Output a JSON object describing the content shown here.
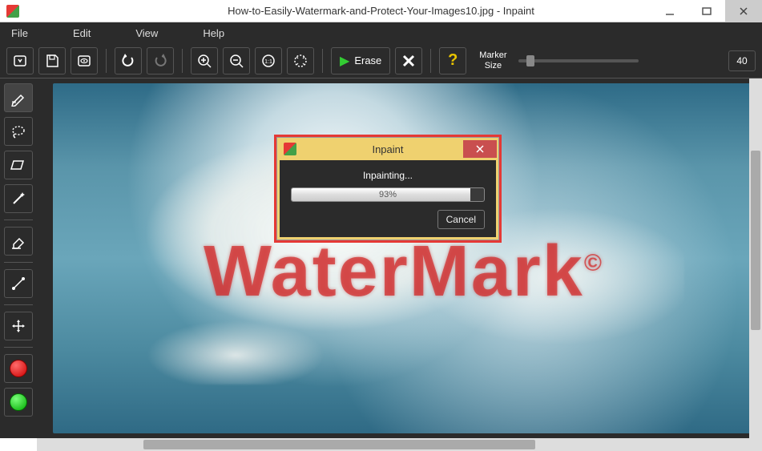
{
  "window": {
    "title": "How-to-Easily-Watermark-and-Protect-Your-Images10.jpg - Inpaint"
  },
  "menubar": {
    "items": [
      "File",
      "Edit",
      "View",
      "Help"
    ]
  },
  "toolbar": {
    "erase_label": "Erase",
    "marker_label_line1": "Marker",
    "marker_label_line2": "Size",
    "marker_value": "40"
  },
  "canvas": {
    "watermark_text": "WaterMark",
    "watermark_symbol": "©"
  },
  "dialog": {
    "title": "Inpaint",
    "status": "Inpainting...",
    "progress_percent": "93%",
    "cancel_label": "Cancel"
  }
}
